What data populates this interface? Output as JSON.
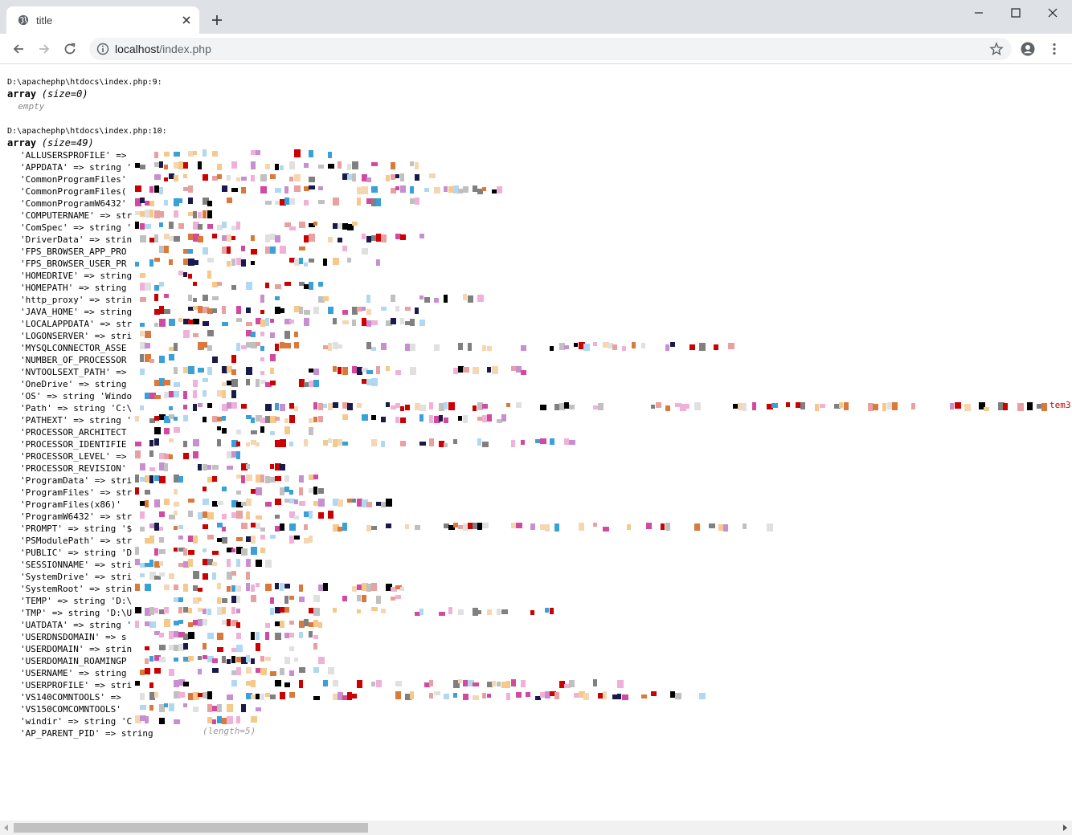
{
  "browser": {
    "tab_title": "title",
    "url_host": "localhost",
    "url_path": "/index.php"
  },
  "icons": {
    "favicon": "globe-icon",
    "tab_close": "close-icon",
    "new_tab": "plus-icon",
    "minimize": "minimize-icon",
    "maximize": "maximize-icon",
    "close_window": "close-icon",
    "back": "arrow-left-icon",
    "forward": "arrow-right-icon",
    "reload": "reload-icon",
    "site_info": "info-icon",
    "bookmark": "star-icon",
    "profile": "account-icon",
    "menu": "kebab-menu-icon"
  },
  "dump1": {
    "file": "D:\\apachephp\\htdocs\\index.php:9:",
    "type": "array",
    "size": "(size=0)",
    "empty": "empty"
  },
  "dump2": {
    "file": "D:\\apachephp\\htdocs\\index.php:10:",
    "type": "array",
    "size": "(size=49)",
    "entries": [
      "'ALLUSERSPROFILE' =>",
      "'APPDATA' => string '",
      "'CommonProgramFiles'",
      "'CommonProgramFiles(",
      "'CommonProgramW6432'",
      "'COMPUTERNAME' => str",
      "'ComSpec' => string '",
      "'DriverData' => strin",
      "'FPS_BROWSER_APP_PRO",
      "'FPS_BROWSER_USER_PR",
      "'HOMEDRIVE' => string",
      "'HOMEPATH' => string",
      "'http_proxy' => strin",
      "'JAVA_HOME' => string",
      "'LOCALAPPDATA' => str",
      "'LOGONSERVER' => stri",
      "'MYSQLCONNECTOR_ASSE",
      "'NUMBER_OF_PROCESSOR",
      "'NVTOOLSEXT_PATH' =>",
      "'OneDrive' => string",
      "'OS' => string 'Windo",
      "'Path' => string 'C:\\",
      "'PATHEXT' => string '",
      "'PROCESSOR_ARCHITECT",
      "'PROCESSOR_IDENTIFIE",
      "'PROCESSOR_LEVEL' =>",
      "'PROCESSOR_REVISION'",
      "'ProgramData' => stri",
      "'ProgramFiles' => str",
      "'ProgramFiles(x86)'",
      "'ProgramW6432' => str",
      "'PROMPT' => string '$",
      "'PSModulePath' => str",
      "'PUBLIC' => string 'D",
      "'SESSIONNAME' => stri",
      "'SystemDrive' => stri",
      "'SystemRoot' => strin",
      "'TEMP' => string 'D:\\",
      "'TMP' => string 'D:\\U",
      "'UATDATA' => string '",
      "'USERDNSDOMAIN' => s",
      "'USERDOMAIN' => strin",
      "'USERDOMAIN_ROAMINGP",
      "'USERNAME' => string",
      "'USERPROFILE' => stri",
      "'VS140COMNTOOLS' =>",
      "'VS150COMCOMNTOOLS'",
      "'windir' => string 'C",
      "'AP_PARENT_PID' => string"
    ],
    "tail_fragment": "tem3",
    "last_len_fragment": "(length=5)"
  }
}
